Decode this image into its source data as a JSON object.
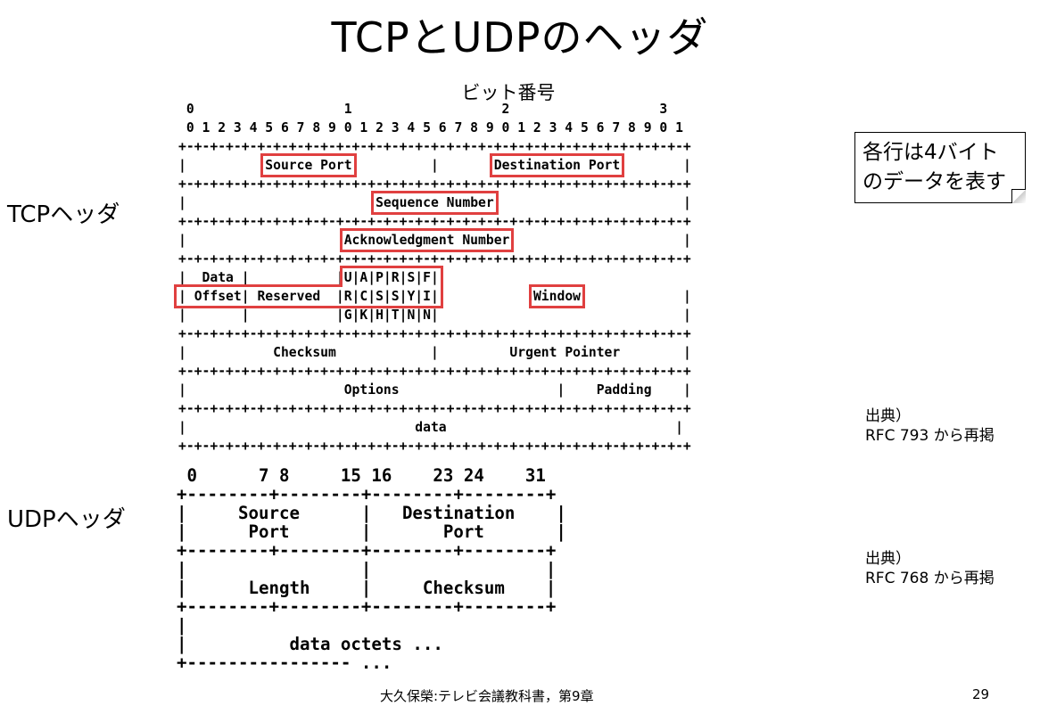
{
  "title": "TCPとUDPのヘッダ",
  "bit_number_label": "ビット番号",
  "tcp_label": "TCPヘッダ",
  "udp_label": "UDPヘッダ",
  "callout": {
    "line1": "各行は4バイト",
    "line2": "のデータを表す"
  },
  "tcp_source": {
    "line1": "出典）",
    "line2": "RFC 793 から再掲"
  },
  "udp_source": {
    "line1": "出典）",
    "line2": "RFC 768 から再掲"
  },
  "tcp_diagram": {
    "bit_tens": "0                   1                   2                   3",
    "bit_ones": "0 1 2 3 4 5 6 7 8 9 0 1 2 3 4 5 6 7 8 9 0 1 2 3 4 5 6 7 8 9 0 1",
    "source_port": "Source Port",
    "destination_port": "Destination Port",
    "sequence_number": "Sequence Number",
    "acknowledgment_number": "Acknowledgment Number",
    "data_offset_1": "Data",
    "data_offset_2": "Offset",
    "reserved": "Reserved",
    "flags_row_1": "U|A|P|R|S|F",
    "flags_row_2": "R|C|S|S|Y|I",
    "flags_row_3": "G|K|H|T|N|N",
    "window": "Window",
    "checksum": "Checksum",
    "urgent_pointer": "Urgent Pointer",
    "options": "Options",
    "padding": "Padding",
    "data": "data"
  },
  "udp_diagram": {
    "bit_positions": "0      7 8     15 16    23 24    31",
    "source_port_1": "Source",
    "source_port_2": "Port",
    "destination_port_1": "Destination",
    "destination_port_2": "Port",
    "length": "Length",
    "checksum": "Checksum",
    "data_octets": "data octets ...",
    "trailing": "..."
  },
  "footer": {
    "citation": "大久保榮:テレビ会議教科書，第9章",
    "page_number": "29"
  }
}
